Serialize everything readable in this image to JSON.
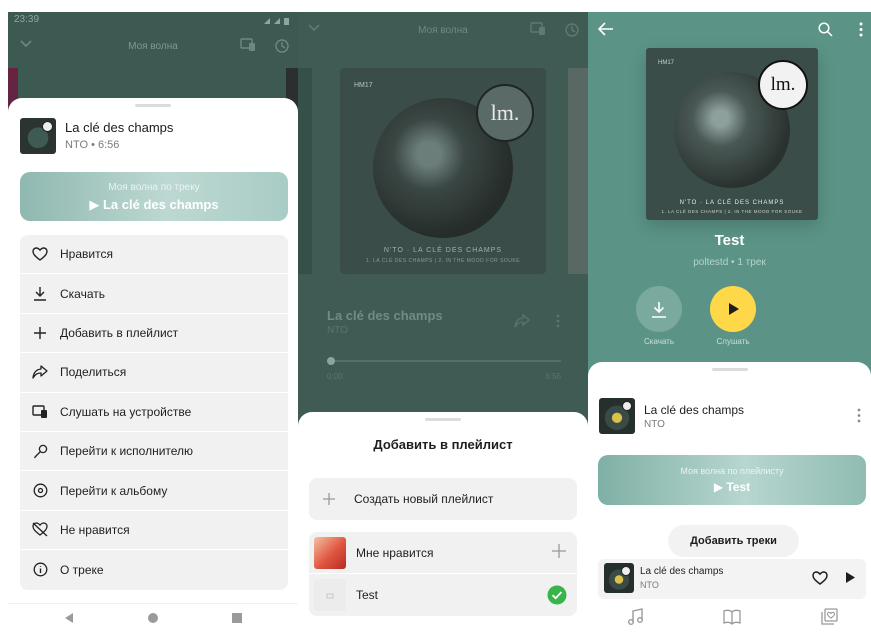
{
  "panel1": {
    "status_time": "23:39",
    "header_title": "Моя волна",
    "track": {
      "title": "La clé des champs",
      "meta": "NTO • 6:56"
    },
    "wave": {
      "line1": "Моя волна по треку",
      "line2": "▶ La clé des champs"
    },
    "menu": [
      {
        "icon": "heart-icon",
        "label": "Нравится"
      },
      {
        "icon": "download-icon",
        "label": "Скачать"
      },
      {
        "icon": "plus-icon",
        "label": "Добавить в плейлист"
      },
      {
        "icon": "share-icon",
        "label": "Поделиться"
      },
      {
        "icon": "device-icon",
        "label": "Слушать на устройстве"
      },
      {
        "icon": "microphone-icon",
        "label": "Перейти к исполнителю"
      },
      {
        "icon": "album-icon",
        "label": "Перейти к альбому"
      },
      {
        "icon": "dislike-icon",
        "label": "Не нравится"
      },
      {
        "icon": "info-icon",
        "label": "О треке"
      }
    ],
    "nav": [
      "back-triangle-icon",
      "home-circle-icon",
      "recents-square-icon"
    ]
  },
  "panel2": {
    "header_title": "Моя волна",
    "album": {
      "label": "HM17",
      "logo": "lm.",
      "caption1": "N'TO · LA CLÉ DES CHAMPS",
      "caption2": "1. LA CLÉ DES CHAMPS | 2. IN THE MOOD FOR SOUKE"
    },
    "track": {
      "title": "La clé des champs",
      "artist": "NTO"
    },
    "time_start": "0:00",
    "time_end": "6:56",
    "progress": 0.0,
    "sheet": {
      "title": "Добавить в плейлист",
      "new_playlist": "Создать новый плейлист",
      "playlists": [
        {
          "name": "Мне нравится",
          "action": "plus-icon"
        },
        {
          "name": "Test",
          "action": "check-icon"
        }
      ]
    }
  },
  "panel3": {
    "album": {
      "label": "HM17",
      "logo": "lm.",
      "caption1": "N'TO · LA CLÉ DES CHAMPS",
      "caption2": "1. LA CLÉ DES CHAMPS | 2. IN THE MOOD FOR SOUKE"
    },
    "playlist_title": "Test",
    "playlist_meta": "poltestd • 1 трек",
    "download_label": "Скачать",
    "listen_label": "Слушать",
    "track": {
      "title": "La clé des champs",
      "artist": "NTO"
    },
    "wave": {
      "line1": "Моя волна по плейлисту",
      "line2": "▶ Test"
    },
    "add_tracks": "Добавить треки",
    "mini_player": {
      "title": "La clé des champs",
      "artist": "NTO"
    },
    "tabs": [
      "music-note-icon",
      "book-icon",
      "collection-heart-icon"
    ]
  },
  "colors": {
    "teal_dark": "#3d5a52",
    "teal_light": "#5b9487",
    "play_yellow": "#ffd84a",
    "check_green": "#38b54a"
  }
}
